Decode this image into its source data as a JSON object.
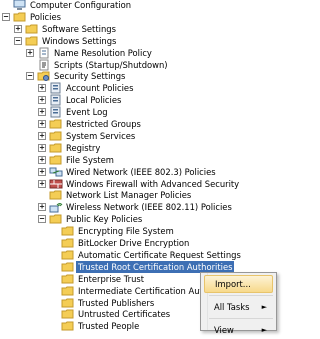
{
  "tree": [
    {
      "label": "Computer Configuration",
      "icon": "computer-icon",
      "expander": "",
      "name": "tree-computer-configuration"
    },
    {
      "label": "Policies",
      "icon": "folder-open-icon",
      "expander": "−",
      "name": "tree-policies"
    },
    {
      "label": "Software Settings",
      "icon": "folder-icon",
      "expander": "+",
      "name": "tree-software-settings"
    },
    {
      "label": "Windows Settings",
      "icon": "folder-open-icon",
      "expander": "−",
      "name": "tree-windows-settings"
    },
    {
      "label": "Name Resolution Policy",
      "icon": "document-icon",
      "expander": "+",
      "name": "tree-name-resolution-policy"
    },
    {
      "label": "Scripts (Startup/Shutdown)",
      "icon": "script-icon",
      "expander": "",
      "name": "tree-scripts"
    },
    {
      "label": "Security Settings",
      "icon": "security-settings-icon",
      "expander": "−",
      "name": "tree-security-settings"
    },
    {
      "label": "Account Policies",
      "icon": "policy-icon",
      "expander": "+",
      "name": "tree-account-policies"
    },
    {
      "label": "Local Policies",
      "icon": "policy-icon",
      "expander": "+",
      "name": "tree-local-policies"
    },
    {
      "label": "Event Log",
      "icon": "policy-icon",
      "expander": "+",
      "name": "tree-event-log"
    },
    {
      "label": "Restricted Groups",
      "icon": "folder-icon",
      "expander": "+",
      "name": "tree-restricted-groups"
    },
    {
      "label": "System Services",
      "icon": "folder-icon",
      "expander": "+",
      "name": "tree-system-services"
    },
    {
      "label": "Registry",
      "icon": "folder-icon",
      "expander": "+",
      "name": "tree-registry"
    },
    {
      "label": "File System",
      "icon": "folder-icon",
      "expander": "+",
      "name": "tree-file-system"
    },
    {
      "label": "Wired Network (IEEE 802.3) Policies",
      "icon": "network-icon",
      "expander": "+",
      "name": "tree-wired-network"
    },
    {
      "label": "Windows Firewall with Advanced Security",
      "icon": "firewall-icon",
      "expander": "+",
      "name": "tree-windows-firewall"
    },
    {
      "label": "Network List Manager Policies",
      "icon": "folder-icon",
      "expander": "",
      "name": "tree-network-list-manager"
    },
    {
      "label": "Wireless Network (IEEE 802.11) Policies",
      "icon": "wireless-icon",
      "expander": "+",
      "name": "tree-wireless-network"
    },
    {
      "label": "Public Key Policies",
      "icon": "folder-open-icon",
      "expander": "−",
      "name": "tree-public-key-policies"
    },
    {
      "label": "Encrypting File System",
      "icon": "folder-icon",
      "expander": "",
      "name": "tree-encrypting-file-system"
    },
    {
      "label": "BitLocker Drive Encryption",
      "icon": "folder-icon",
      "expander": "",
      "name": "tree-bitlocker"
    },
    {
      "label": "Automatic Certificate Request Settings",
      "icon": "folder-icon",
      "expander": "",
      "name": "tree-auto-cert-request"
    },
    {
      "label": "Trusted Root Certification Authorities",
      "icon": "folder-icon",
      "expander": "",
      "name": "tree-trusted-root-ca"
    },
    {
      "label": "Enterprise Trust",
      "icon": "folder-icon",
      "expander": "",
      "name": "tree-enterprise-trust"
    },
    {
      "label": "Intermediate Certification Authorities",
      "icon": "folder-icon",
      "expander": "",
      "name": "tree-intermediate-ca"
    },
    {
      "label": "Trusted Publishers",
      "icon": "folder-icon",
      "expander": "",
      "name": "tree-trusted-publishers"
    },
    {
      "label": "Untrusted Certificates",
      "icon": "folder-icon",
      "expander": "",
      "name": "tree-untrusted-certificates"
    },
    {
      "label": "Trusted People",
      "icon": "folder-icon",
      "expander": "",
      "name": "tree-trusted-people"
    }
  ],
  "selected_item": "Trusted Root Certification Authorities",
  "context_menu": {
    "import_label": "Import...",
    "all_tasks_label": "All Tasks",
    "view_label": "View",
    "submenu_arrow": "►"
  },
  "colors": {
    "selection": "#3d6fb4",
    "menu_hover": "#f7d98b",
    "folder": "#f4cd55"
  }
}
